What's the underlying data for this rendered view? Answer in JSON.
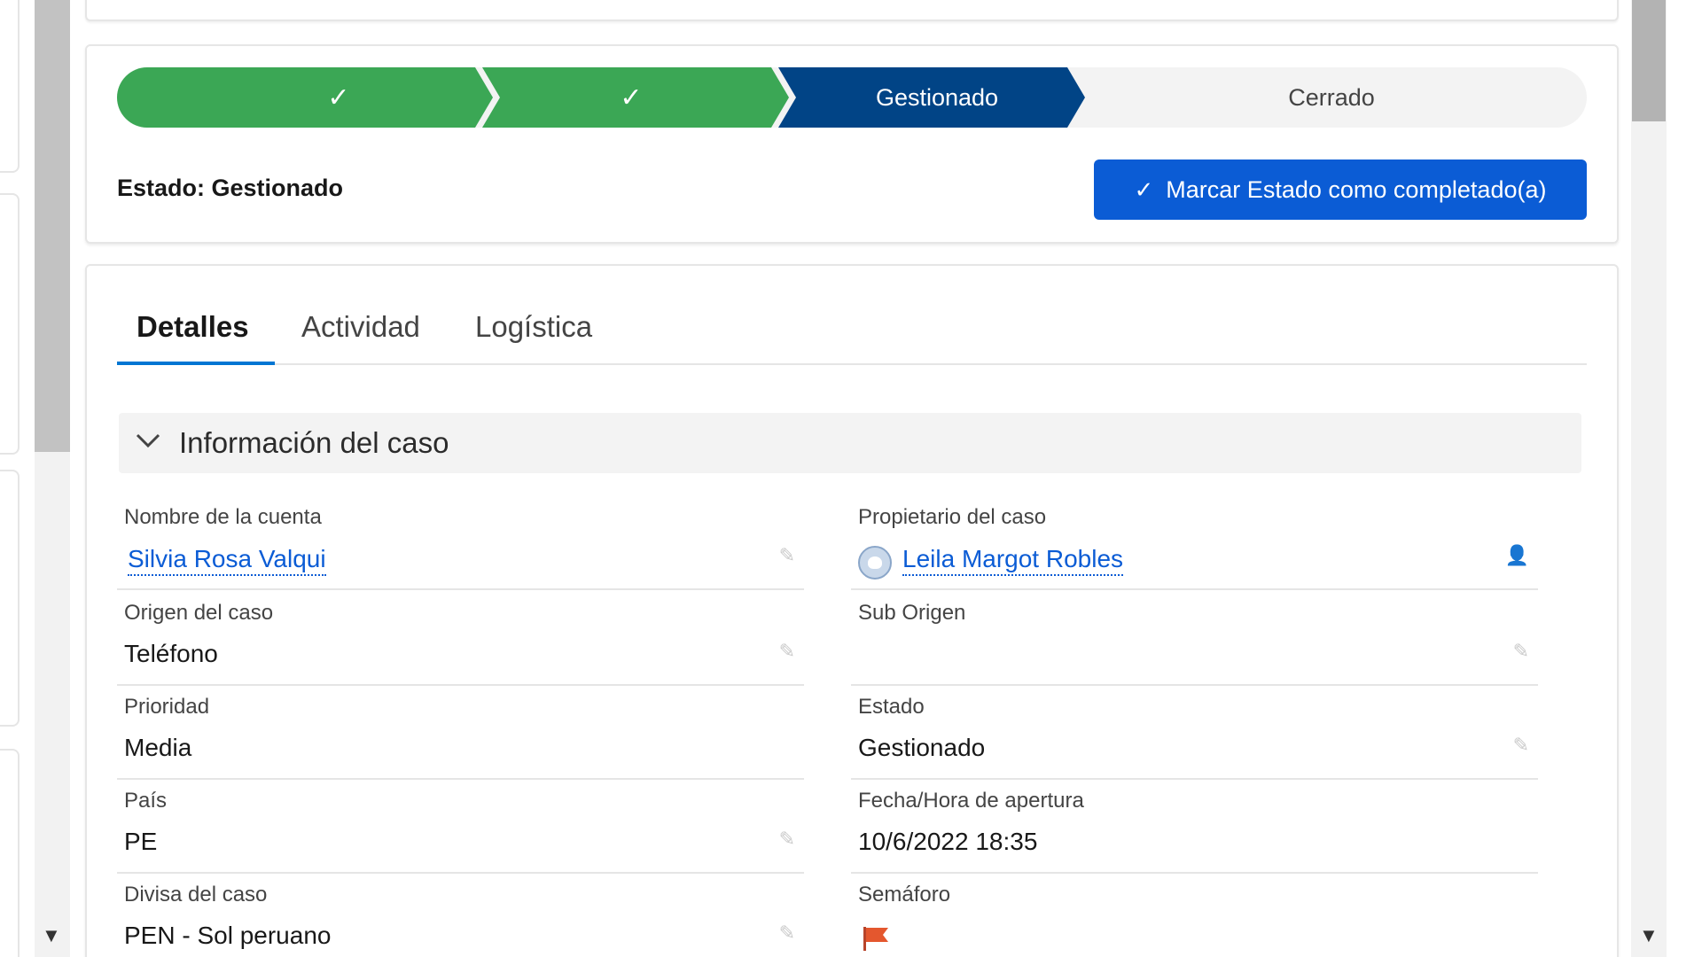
{
  "path": {
    "stages": [
      {
        "label": "",
        "state": "complete",
        "icon": "check-icon"
      },
      {
        "label": "",
        "state": "complete",
        "icon": "check-icon"
      },
      {
        "label": "Gestionado",
        "state": "current"
      },
      {
        "label": "Cerrado",
        "state": "incomplete"
      }
    ],
    "check_glyph": "✓",
    "estado_text": "Estado: Gestionado",
    "mark_button_label": "Marcar Estado como completado(a)",
    "colors": {
      "complete": "#3ba755",
      "current": "#014486",
      "incomplete": "#f3f3f3",
      "button": "#0b5cd5"
    }
  },
  "tabs": [
    {
      "label": "Detalles",
      "active": true
    },
    {
      "label": "Actividad",
      "active": false
    },
    {
      "label": "Logística",
      "active": false
    }
  ],
  "section": {
    "title": "Información del caso",
    "chevron": "chevron-down-icon"
  },
  "fields": {
    "nombre_cuenta": {
      "label": "Nombre de la cuenta",
      "value": "Silvia Rosa Valqui"
    },
    "propietario": {
      "label": "Propietario del caso",
      "value": "Leila Margot Robles"
    },
    "origen": {
      "label": "Origen del caso",
      "value": "Teléfono"
    },
    "sub_origen": {
      "label": "Sub Origen",
      "value": ""
    },
    "prioridad": {
      "label": "Prioridad",
      "value": "Media"
    },
    "estado": {
      "label": "Estado",
      "value": "Gestionado"
    },
    "pais": {
      "label": "País",
      "value": "PE"
    },
    "fecha_apertura": {
      "label": "Fecha/Hora de apertura",
      "value": "10/6/2022 18:35"
    },
    "divisa": {
      "label": "Divisa del caso",
      "value": "PEN - Sol peruano"
    },
    "semaforo": {
      "label": "Semáforo",
      "value": "",
      "icon": "flag-icon",
      "color": "#e4572e"
    }
  },
  "icons": {
    "edit": "✎",
    "down_arrow": "▼",
    "chevron": "⌵"
  }
}
